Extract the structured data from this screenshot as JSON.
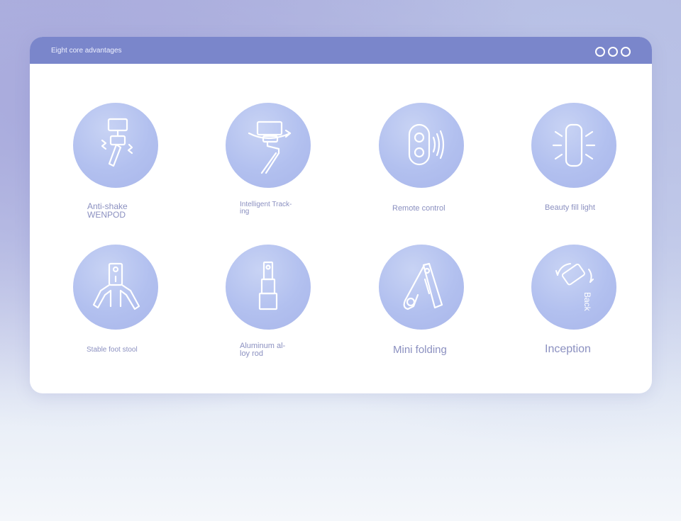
{
  "window": {
    "title": "Eight core advantages"
  },
  "features": [
    {
      "label_line1": "Anti-shake",
      "label_line2": "WENPOD",
      "icon": "gimbal-stick-icon"
    },
    {
      "label_line1": "Intelligent Track-",
      "label_line2": "ing",
      "icon": "tracking-icon"
    },
    {
      "label_line1": "Remote control",
      "label_line2": "",
      "icon": "remote-icon"
    },
    {
      "label_line1": "Beauty fill light",
      "label_line2": "",
      "icon": "fill-light-icon"
    },
    {
      "label_line1": "Stable foot stool",
      "label_line2": "",
      "icon": "tripod-icon"
    },
    {
      "label_line1": "Aluminum al-",
      "label_line2": "loy rod",
      "icon": "extension-rod-icon"
    },
    {
      "label_line1": "Mini folding",
      "label_line2": "",
      "icon": "folding-icon"
    },
    {
      "label_line1": "Inception",
      "label_line2": "",
      "icon": "rotate-icon",
      "icon_text": "Back"
    }
  ]
}
